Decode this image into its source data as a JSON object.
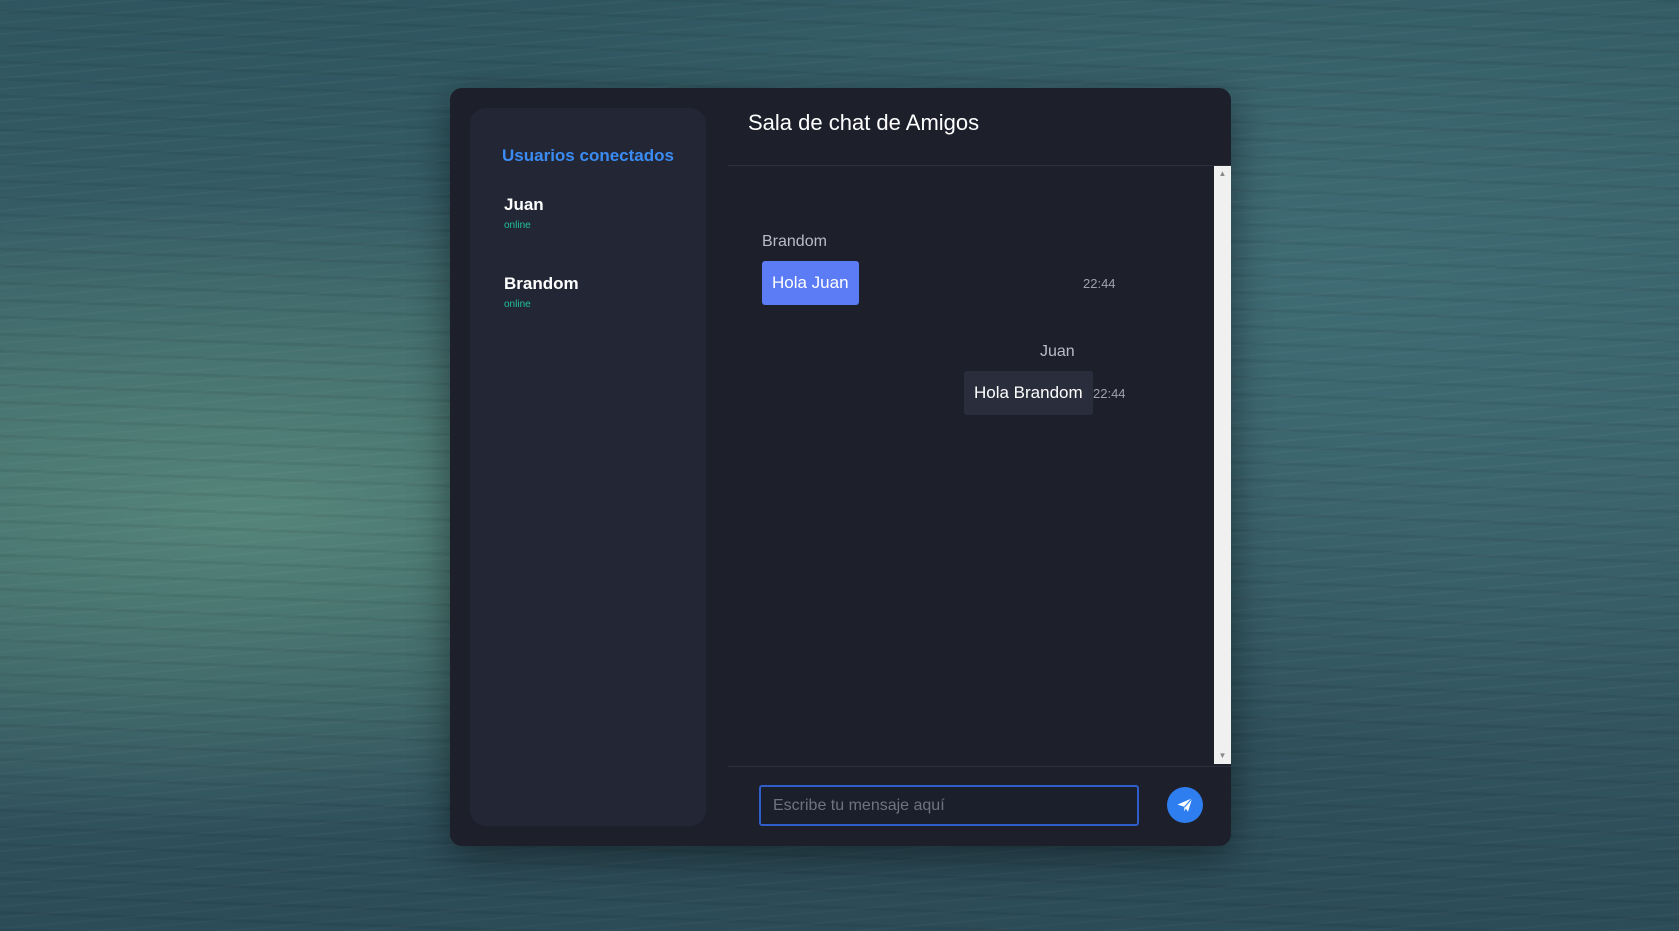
{
  "sidebar": {
    "title": "Usuarios conectados",
    "users": [
      {
        "name": "Juan",
        "status": "online"
      },
      {
        "name": "Brandom",
        "status": "online"
      }
    ]
  },
  "chat": {
    "title": "Sala de chat de Amigos",
    "messages": [
      {
        "sender": "Brandom",
        "text": "Hola Juan",
        "time": "22:44",
        "direction": "incoming"
      },
      {
        "sender": "Juan",
        "text": "Hola Brandom",
        "time": "22:44",
        "direction": "outgoing"
      }
    ]
  },
  "composer": {
    "placeholder": "Escribe tu mensaje aquí",
    "value": "",
    "send_icon": "paper-plane-icon"
  },
  "colors": {
    "accent": "#3b8cf2",
    "online": "#22c39b",
    "incoming_bubble": "#5b7cf5",
    "outgoing_bubble": "#2a2d3b",
    "panel": "#1d1f2b"
  }
}
